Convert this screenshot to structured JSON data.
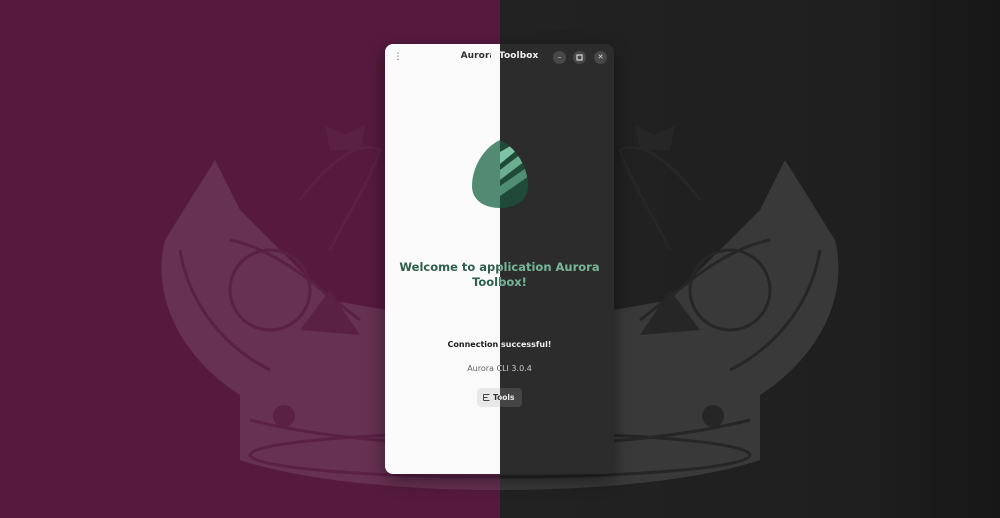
{
  "window": {
    "title": "Aurora Toolbox",
    "menu_icon": "vertical-dots-icon",
    "minimize_icon": "minimize-icon",
    "maximize_icon": "maximize-icon",
    "close_icon": "close-icon",
    "minimize_glyph": "–",
    "maximize_glyph": "▫",
    "close_glyph": "✕"
  },
  "main": {
    "logo_icon": "aurora-leaf-logo-icon",
    "welcome_line1": "Welcome to application Aurora",
    "welcome_line2": "Toolbox!",
    "status": "Connection successful!",
    "version": "Aurora CLI 3.0.4",
    "tools_button": {
      "label": "Tools",
      "icon": "tools-list-icon"
    }
  },
  "background": {
    "left_color": "#561a3d",
    "right_color": "#222222",
    "decoration": "crown-icon"
  },
  "colors": {
    "accent_light": "#2e5f4c",
    "accent_dark": "#78b398",
    "logo_green": "#4e8c74"
  }
}
